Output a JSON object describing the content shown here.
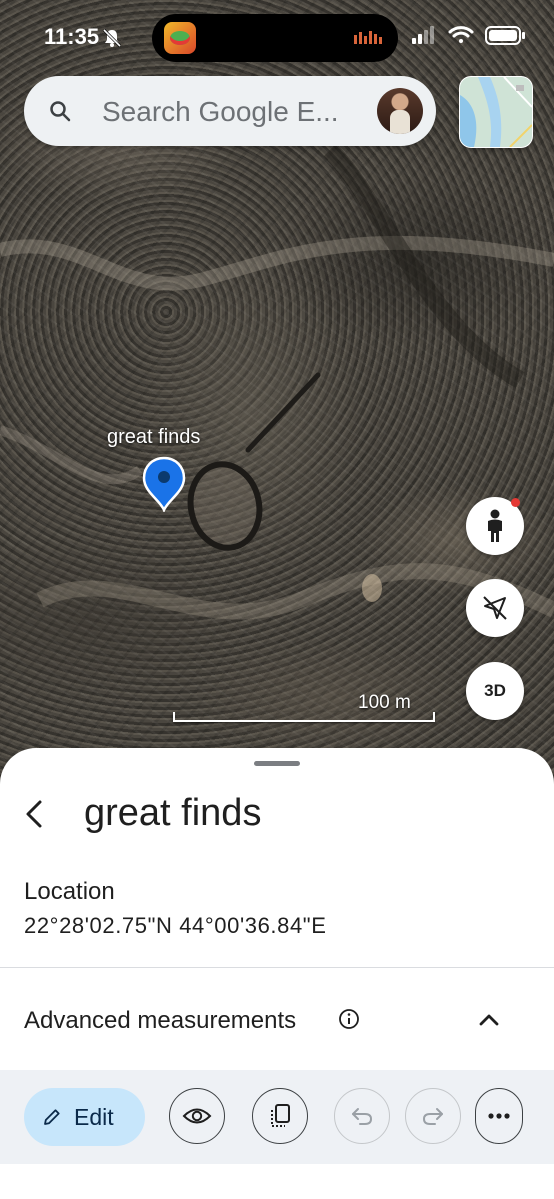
{
  "status_bar": {
    "time": "11:35",
    "icons": [
      "bell-slash-icon",
      "signal-icon",
      "wifi-icon",
      "battery-icon"
    ]
  },
  "search": {
    "placeholder": "Search Google E..."
  },
  "map": {
    "placemark_label": "great finds",
    "scale_label": "100 m",
    "fab_3d_label": "3D",
    "fab_icons": [
      "street-view-person-icon",
      "compass-off-icon"
    ]
  },
  "sheet": {
    "title": "great finds",
    "location_label": "Location",
    "location_value": "22°28'02.75\"N 44°00'36.84\"E",
    "advanced_label": "Advanced measurements"
  },
  "toolbar": {
    "edit_label": "Edit",
    "buttons": [
      "eye-icon",
      "copy-icon",
      "undo-icon",
      "redo-icon",
      "more-icon"
    ]
  },
  "colors": {
    "accent_blue": "#1a73e8",
    "edit_button_bg": "#c7e6fb",
    "sheet_bg": "#ffffff",
    "toolbar_bg": "#eef1f5"
  }
}
